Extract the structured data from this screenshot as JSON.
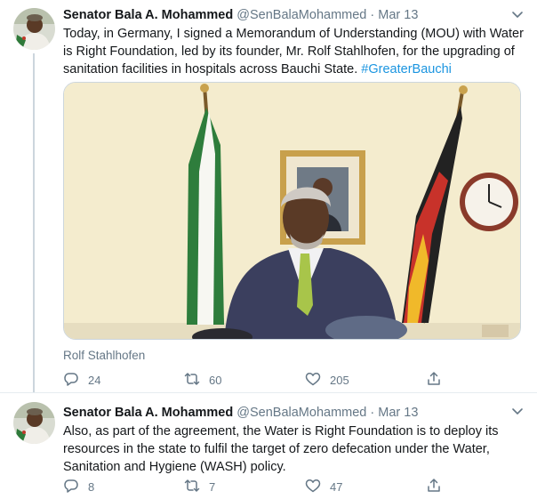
{
  "tweets": [
    {
      "name": "Senator Bala A. Mohammed",
      "handle": "@SenBalaMohammed",
      "separator": "·",
      "date": "Mar 13",
      "text": "Today, in Germany, I signed a Memorandum of Understanding (MOU) with Water is Right Foundation, led by its founder, Mr. Rolf Stahlhofen, for the upgrading of sanitation facilities in hospitals across Bauchi State.",
      "hashtag": "#GreaterBauchi",
      "media_credit": "Rolf Stahlhofen",
      "replies": "24",
      "retweets": "60",
      "likes": "205"
    },
    {
      "name": "Senator Bala A. Mohammed",
      "handle": "@SenBalaMohammed",
      "separator": "·",
      "date": "Mar 13",
      "text": "Also, as part of the agreement, the Water is Right Foundation is to deploy its resources in the state to fulfil the target of zero defecation under the Water, Sanitation and Hygiene (WASH) policy.",
      "replies": "8",
      "retweets": "7",
      "likes": "47"
    }
  ],
  "icons": {
    "reply": "reply-icon",
    "retweet": "retweet-icon",
    "like": "heart-icon",
    "share": "share-icon",
    "caret": "chevron-down-icon"
  },
  "colors": {
    "text": "#14171a",
    "secondary": "#657786",
    "link": "#1b95e0",
    "divider": "#e6ecf0"
  }
}
